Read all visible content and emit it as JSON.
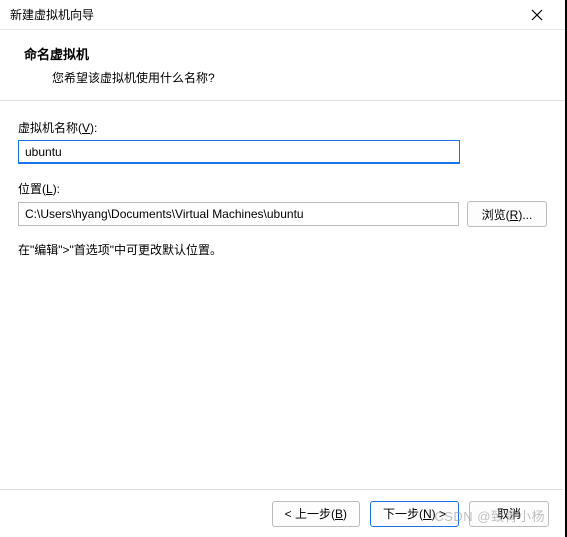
{
  "titlebar": {
    "title": "新建虚拟机向导"
  },
  "header": {
    "heading": "命名虚拟机",
    "subheading": "您希望该虚拟机使用什么名称?"
  },
  "fields": {
    "name_label_pre": "虚拟机名称(",
    "name_label_key": "V",
    "name_label_post": "):",
    "name_value": "ubuntu",
    "location_label_pre": "位置(",
    "location_label_key": "L",
    "location_label_post": "):",
    "location_value": "C:\\Users\\hyang\\Documents\\Virtual Machines\\ubuntu",
    "browse_label_pre": "浏览(",
    "browse_label_key": "R",
    "browse_label_post": ")..."
  },
  "hint": "在\"编辑\">\"首选项\"中可更改默认位置。",
  "footer": {
    "back_pre": "< 上一步(",
    "back_key": "B",
    "back_post": ")",
    "next_pre": "下一步(",
    "next_key": "N",
    "next_post": ") >",
    "cancel": "取消"
  },
  "watermark": "CSDN @致青小杨"
}
